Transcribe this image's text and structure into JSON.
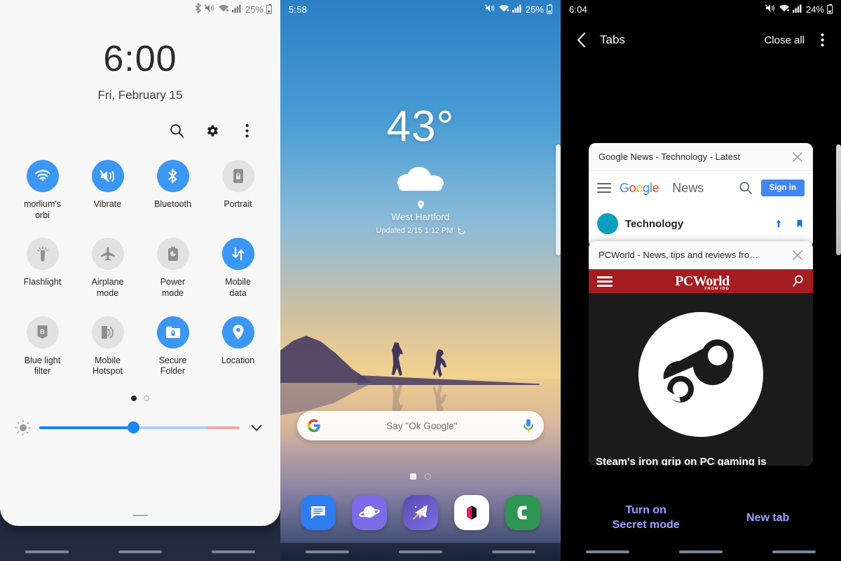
{
  "screens": {
    "quick_settings": {
      "status_bar": {
        "icons": [
          "bluetooth-icon",
          "vibrate-icon",
          "wifi-icon",
          "signal-icon"
        ],
        "battery_pct": "25%"
      },
      "clock": {
        "time": "6:00",
        "date": "Fri, February 15"
      },
      "actions": [
        {
          "name": "search-icon",
          "label": "Search"
        },
        {
          "name": "gear-icon",
          "label": "Settings"
        },
        {
          "name": "more-vert-icon",
          "label": "More options"
        }
      ],
      "tiles": [
        {
          "label": "morlium's\norbi",
          "icon": "wifi-icon",
          "state": "on"
        },
        {
          "label": "Vibrate",
          "icon": "vibrate-icon",
          "state": "on"
        },
        {
          "label": "Bluetooth",
          "icon": "bluetooth-icon",
          "state": "on"
        },
        {
          "label": "Portrait",
          "icon": "rotation-lock-icon",
          "state": "off"
        },
        {
          "label": "Flashlight",
          "icon": "flashlight-icon",
          "state": "off"
        },
        {
          "label": "Airplane\nmode",
          "icon": "airplane-icon",
          "state": "off"
        },
        {
          "label": "Power\nmode",
          "icon": "battery-power-icon",
          "state": "off"
        },
        {
          "label": "Mobile\ndata",
          "icon": "data-arrows-icon",
          "state": "on"
        },
        {
          "label": "Blue light\nfilter",
          "icon": "blue-light-icon",
          "state": "off"
        },
        {
          "label": "Mobile\nHotspot",
          "icon": "hotspot-icon",
          "state": "off"
        },
        {
          "label": "Secure\nFolder",
          "icon": "secure-folder-icon",
          "state": "on"
        },
        {
          "label": "Location",
          "icon": "location-pin-icon",
          "state": "on"
        }
      ],
      "page_dots": {
        "count": 2,
        "active_index": 0
      },
      "brightness": {
        "icon": "brightness-icon",
        "value_pct": 47,
        "expand_icon": "chevron-down-icon"
      },
      "accent_color": "#3b97f3",
      "panel_bg": "#f7f7f7"
    },
    "home": {
      "status_bar": {
        "time": "5:58",
        "icons": [
          "vibrate-icon",
          "wifi-icon",
          "signal-icon"
        ],
        "battery_pct": "25%"
      },
      "weather": {
        "temperature": "43°",
        "condition_icon": "cloud-icon",
        "location": "West Hartford",
        "location_icon": "location-pin-icon",
        "updated": "Updated 2/15 1:12 PM",
        "refresh_icon": "refresh-icon"
      },
      "search": {
        "logo": "google-g-icon",
        "placeholder": "Say \"Ok Google\"",
        "mic_icon": "microphone-icon"
      },
      "page_indicator": {
        "count": 2,
        "active_index": 0
      },
      "dock": [
        {
          "name": "messages-app",
          "label": "Messages",
          "color": "#2f7df0"
        },
        {
          "name": "internet-app",
          "label": "Internet",
          "color": "#7d6ce8"
        },
        {
          "name": "galaxy-apps-app",
          "label": "Galaxy Apps",
          "color": "#5645a8"
        },
        {
          "name": "gallery-app",
          "label": "Gallery",
          "color": "#ffffff"
        },
        {
          "name": "phone-app",
          "label": "Phone",
          "color": "#2e9553"
        }
      ]
    },
    "tabs": {
      "status_bar": {
        "time": "6:04",
        "icons": [
          "vibrate-icon",
          "wifi-icon",
          "signal-icon"
        ],
        "battery_pct": "24%"
      },
      "header": {
        "back_icon": "chevron-left-icon",
        "title": "Tabs",
        "close_all_label": "Close all",
        "more_icon": "more-vert-icon"
      },
      "cards": [
        {
          "title": "Google News - Technology - Latest",
          "close_icon": "close-icon",
          "page": {
            "menu_icon": "hamburger-icon",
            "brand_letters": [
              "G",
              "o",
              "o",
              "g",
              "l",
              "e"
            ],
            "brand_suffix": "News",
            "search_icon": "search-icon",
            "signin_label": "Sign in",
            "section": "Technology"
          }
        },
        {
          "title": "PCWorld - News, tips and reviews fro…",
          "close_icon": "close-icon",
          "page": {
            "menu_icon": "hamburger-icon",
            "brand": "PCWorld",
            "brand_sub": "FROM IDG",
            "search_icon": "search-icon",
            "hero_icon": "steam-logo-icon",
            "headline": "Steam's iron grip on PC gaming is"
          }
        }
      ],
      "footer": {
        "secret_mode_label": "Turn on\nSecret mode",
        "new_tab_label": "New tab"
      },
      "link_color": "#9ba1ff",
      "bg_color": "#000000"
    }
  }
}
